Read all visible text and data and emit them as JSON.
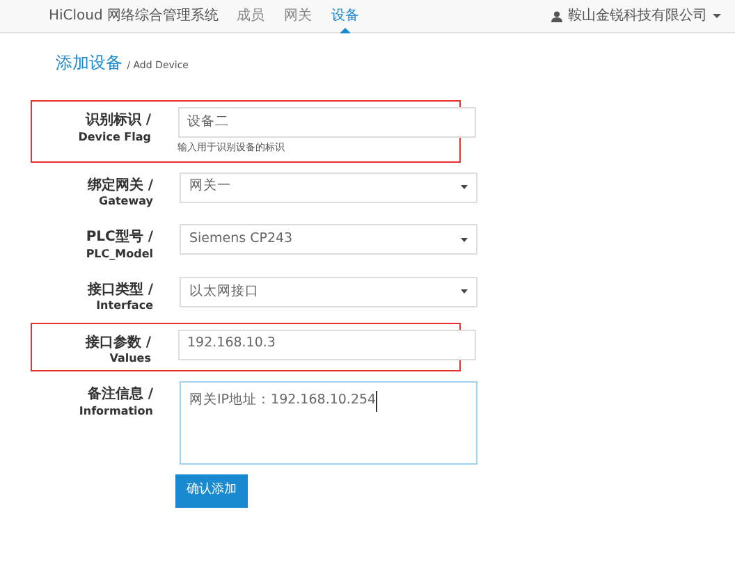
{
  "navbar": {
    "brand": "HiCloud 网络综合管理系统",
    "items": [
      {
        "label": "成员",
        "selected": false
      },
      {
        "label": "网关",
        "selected": false
      },
      {
        "label": "设备",
        "selected": true
      }
    ],
    "user": "鞍山金锐科技有限公司"
  },
  "heading": {
    "title": "添加设备",
    "subtitle": "/ Add Device"
  },
  "fields": [
    {
      "kind": "input",
      "label": "识别标识 /",
      "label_en": "Device Flag",
      "value": "设备二",
      "help": "输入用于识别设备的标识",
      "highlighted": true
    },
    {
      "kind": "select",
      "label": "绑定网关 /",
      "label_en": "Gateway",
      "value": "网关一",
      "highlighted": false
    },
    {
      "kind": "select",
      "label": "PLC型号 /",
      "label_en": "PLC_Model",
      "value": "Siemens CP243",
      "highlighted": false
    },
    {
      "kind": "select",
      "label": "接口类型 /",
      "label_en": "Interface",
      "value": "以太网接口",
      "highlighted": false
    },
    {
      "kind": "input",
      "label": "接口参数 /",
      "label_en": "Values",
      "value": "192.168.10.3",
      "highlighted": true
    },
    {
      "kind": "textarea",
      "label": "备注信息 /",
      "label_en": "Information",
      "value": "网关IP地址：192.168.10.254",
      "highlighted": false,
      "focused": true
    }
  ],
  "submit": "确认添加"
}
